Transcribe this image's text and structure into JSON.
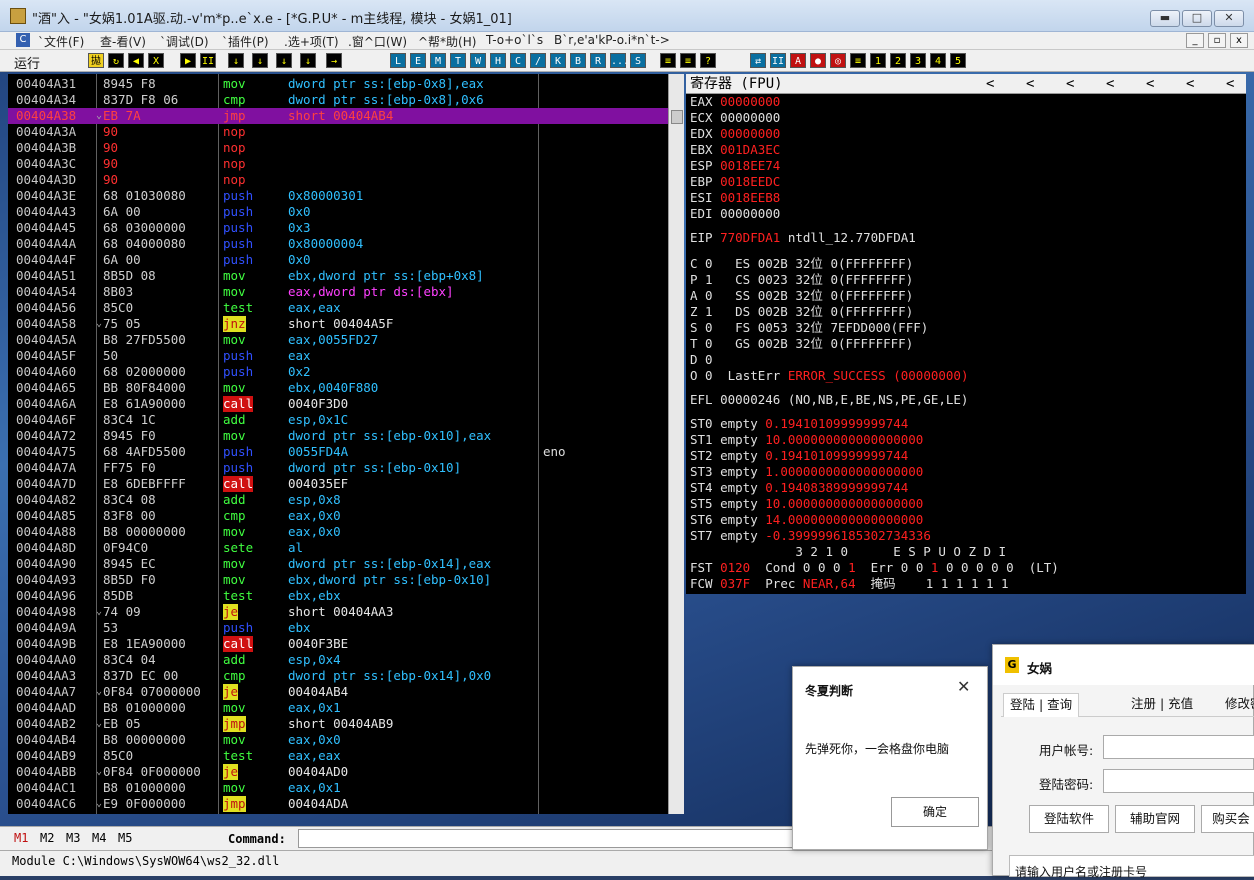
{
  "window": {
    "title": "\"酒\"入 - \"女娲1.01A驱.动.-v'm*p..e`x.e - [*G.P.U* - m主线程, 模块 - 女娲1_01]",
    "min": "▬",
    "max": "□",
    "close": "✕"
  },
  "menu": {
    "items": [
      "`文件(F)",
      "查-看(V)",
      "`调试(D)",
      "`插件(P)",
      ".选+项(T)",
      ".窗^口(W)",
      "^帮*助(H)",
      "T-o+o`l`s",
      "B`r,e'a'kP-o.i*n`t->"
    ],
    "c_icon": "C"
  },
  "toolbar": {
    "run_label": "运行",
    "buttons": [
      "拋",
      "↻",
      "◀",
      "X",
      "▶",
      "II",
      "↓",
      "↓",
      "↓",
      "↓",
      "→",
      "L",
      "E",
      "M",
      "T",
      "W",
      "H",
      "C",
      "/",
      "K",
      "B",
      "R",
      "...",
      "S",
      "≡",
      "≡",
      "?",
      "⇄",
      "II",
      "A",
      "●",
      "◎",
      "≡",
      "1",
      "2",
      "3",
      "4",
      "5"
    ]
  },
  "disasm": [
    {
      "addr": "00404A31",
      "hex": "8945 F8",
      "ins": "mov",
      "ops": "dword ptr ss:[ebp-0x8],eax",
      "c": ""
    },
    {
      "addr": "00404A34",
      "hex": "837D F8 06",
      "ins": "cmp",
      "ops": "dword ptr ss:[ebp-0x8],0x6",
      "c": ""
    },
    {
      "addr": "00404A38",
      "hex": "EB 7A",
      "ins": "jmp",
      "ops": "short 00404AB4",
      "c": "",
      "sel": true
    },
    {
      "addr": "00404A3A",
      "hex": "90",
      "ins": "nop",
      "ops": "",
      "c": ""
    },
    {
      "addr": "00404A3B",
      "hex": "90",
      "ins": "nop",
      "ops": "",
      "c": ""
    },
    {
      "addr": "00404A3C",
      "hex": "90",
      "ins": "nop",
      "ops": "",
      "c": ""
    },
    {
      "addr": "00404A3D",
      "hex": "90",
      "ins": "nop",
      "ops": "",
      "c": ""
    },
    {
      "addr": "00404A3E",
      "hex": "68 01030080",
      "ins": "push",
      "ops": "0x80000301",
      "c": ""
    },
    {
      "addr": "00404A43",
      "hex": "6A 00",
      "ins": "push",
      "ops": "0x0",
      "c": ""
    },
    {
      "addr": "00404A45",
      "hex": "68 03000000",
      "ins": "push",
      "ops": "0x3",
      "c": ""
    },
    {
      "addr": "00404A4A",
      "hex": "68 04000080",
      "ins": "push",
      "ops": "0x80000004",
      "c": ""
    },
    {
      "addr": "00404A4F",
      "hex": "6A 00",
      "ins": "push",
      "ops": "0x0",
      "c": ""
    },
    {
      "addr": "00404A51",
      "hex": "8B5D 08",
      "ins": "mov",
      "ops": "ebx,dword ptr ss:[ebp+0x8]",
      "c": ""
    },
    {
      "addr": "00404A54",
      "hex": "8B03",
      "ins": "mov",
      "ops": "eax,dword ptr ds:[ebx]",
      "c": ""
    },
    {
      "addr": "00404A56",
      "hex": "85C0",
      "ins": "test",
      "ops": "eax,eax",
      "c": ""
    },
    {
      "addr": "00404A58",
      "hex": "75 05",
      "ins": "jnz",
      "ops": "short 00404A5F",
      "c": ""
    },
    {
      "addr": "00404A5A",
      "hex": "B8 27FD5500",
      "ins": "mov",
      "ops": "eax,0055FD27",
      "c": ""
    },
    {
      "addr": "00404A5F",
      "hex": "50",
      "ins": "push",
      "ops": "eax",
      "c": ""
    },
    {
      "addr": "00404A60",
      "hex": "68 02000000",
      "ins": "push",
      "ops": "0x2",
      "c": ""
    },
    {
      "addr": "00404A65",
      "hex": "BB 80F84000",
      "ins": "mov",
      "ops": "ebx,0040F880",
      "c": ""
    },
    {
      "addr": "00404A6A",
      "hex": "E8 61A90000",
      "ins": "call",
      "ops": "0040F3D0",
      "c": ""
    },
    {
      "addr": "00404A6F",
      "hex": "83C4 1C",
      "ins": "add",
      "ops": "esp,0x1C",
      "c": ""
    },
    {
      "addr": "00404A72",
      "hex": "8945 F0",
      "ins": "mov",
      "ops": "dword ptr ss:[ebp-0x10],eax",
      "c": ""
    },
    {
      "addr": "00404A75",
      "hex": "68 4AFD5500",
      "ins": "push",
      "ops": "0055FD4A",
      "c": "eno"
    },
    {
      "addr": "00404A7A",
      "hex": "FF75 F0",
      "ins": "push",
      "ops": "dword ptr ss:[ebp-0x10]",
      "c": ""
    },
    {
      "addr": "00404A7D",
      "hex": "E8 6DEBFFFF",
      "ins": "call",
      "ops": "004035EF",
      "c": ""
    },
    {
      "addr": "00404A82",
      "hex": "83C4 08",
      "ins": "add",
      "ops": "esp,0x8",
      "c": ""
    },
    {
      "addr": "00404A85",
      "hex": "83F8 00",
      "ins": "cmp",
      "ops": "eax,0x0",
      "c": ""
    },
    {
      "addr": "00404A88",
      "hex": "B8 00000000",
      "ins": "mov",
      "ops": "eax,0x0",
      "c": ""
    },
    {
      "addr": "00404A8D",
      "hex": "0F94C0",
      "ins": "sete",
      "ops": "al",
      "c": ""
    },
    {
      "addr": "00404A90",
      "hex": "8945 EC",
      "ins": "mov",
      "ops": "dword ptr ss:[ebp-0x14],eax",
      "c": ""
    },
    {
      "addr": "00404A93",
      "hex": "8B5D F0",
      "ins": "mov",
      "ops": "ebx,dword ptr ss:[ebp-0x10]",
      "c": ""
    },
    {
      "addr": "00404A96",
      "hex": "85DB",
      "ins": "test",
      "ops": "ebx,ebx",
      "c": ""
    },
    {
      "addr": "00404A98",
      "hex": "74 09",
      "ins": "je",
      "ops": "short 00404AA3",
      "c": ""
    },
    {
      "addr": "00404A9A",
      "hex": "53",
      "ins": "push",
      "ops": "ebx",
      "c": ""
    },
    {
      "addr": "00404A9B",
      "hex": "E8 1EA90000",
      "ins": "call",
      "ops": "0040F3BE",
      "c": ""
    },
    {
      "addr": "00404AA0",
      "hex": "83C4 04",
      "ins": "add",
      "ops": "esp,0x4",
      "c": ""
    },
    {
      "addr": "00404AA3",
      "hex": "837D EC 00",
      "ins": "cmp",
      "ops": "dword ptr ss:[ebp-0x14],0x0",
      "c": ""
    },
    {
      "addr": "00404AA7",
      "hex": "0F84 07000000",
      "ins": "je",
      "ops": "00404AB4",
      "c": ""
    },
    {
      "addr": "00404AAD",
      "hex": "B8 01000000",
      "ins": "mov",
      "ops": "eax,0x1",
      "c": ""
    },
    {
      "addr": "00404AB2",
      "hex": "EB 05",
      "ins": "jmp",
      "ops": "short 00404AB9",
      "c": ""
    },
    {
      "addr": "00404AB4",
      "hex": "B8 00000000",
      "ins": "mov",
      "ops": "eax,0x0",
      "c": ""
    },
    {
      "addr": "00404AB9",
      "hex": "85C0",
      "ins": "test",
      "ops": "eax,eax",
      "c": ""
    },
    {
      "addr": "00404ABB",
      "hex": "0F84 0F000000",
      "ins": "je",
      "ops": "00404AD0",
      "c": ""
    },
    {
      "addr": "00404AC1",
      "hex": "B8 01000000",
      "ins": "mov",
      "ops": "eax,0x1",
      "c": ""
    },
    {
      "addr": "00404AC6",
      "hex": "E9 0F000000",
      "ins": "jmp",
      "ops": "00404ADA",
      "c": ""
    }
  ],
  "registers": {
    "title": "寄存器 (FPU)",
    "nav": [
      "<",
      "<",
      "<",
      "<",
      "<",
      "<",
      "<"
    ],
    "gp": [
      [
        "EAX",
        "00000000",
        true
      ],
      [
        "ECX",
        "00000000",
        false
      ],
      [
        "EDX",
        "00000000",
        true
      ],
      [
        "EBX",
        "001DA3EC",
        true
      ],
      [
        "ESP",
        "0018EE74",
        true
      ],
      [
        "EBP",
        "0018EEDC",
        true
      ],
      [
        "ESI",
        "0018EEB8",
        true
      ],
      [
        "EDI",
        "00000000",
        false
      ]
    ],
    "eip_label": "EIP",
    "eip_val": "770DFDA1",
    "eip_sym": "ntdll_12.770DFDA1",
    "flags": [
      {
        "f": "C 0",
        "seg": "ES 002B 32位 0(FFFFFFFF)"
      },
      {
        "f": "P 1",
        "seg": "CS 0023 32位 0(FFFFFFFF)"
      },
      {
        "f": "A 0",
        "seg": "SS 002B 32位 0(FFFFFFFF)"
      },
      {
        "f": "Z 1",
        "seg": "DS 002B 32位 0(FFFFFFFF)"
      },
      {
        "f": "S 0",
        "seg": "FS 0053 32位 7EFDD000(FFF)"
      },
      {
        "f": "T 0",
        "seg": "GS 002B 32位 0(FFFFFFFF)"
      },
      {
        "f": "D 0",
        "seg": ""
      }
    ],
    "o_flag": "O 0",
    "lasterr_label": "LastErr",
    "lasterr_val": "ERROR_SUCCESS (00000000)",
    "efl": "EFL 00000246 (NO,NB,E,BE,NS,PE,GE,LE)",
    "st": [
      [
        "ST0",
        "empty",
        "0.19410109999999744"
      ],
      [
        "ST1",
        "empty",
        "10.000000000000000000"
      ],
      [
        "ST2",
        "empty",
        "0.19410109999999744"
      ],
      [
        "ST3",
        "empty",
        "1.0000000000000000000"
      ],
      [
        "ST4",
        "empty",
        "0.19408389999999744"
      ],
      [
        "ST5",
        "empty",
        "10.000000000000000000"
      ],
      [
        "ST6",
        "empty",
        "14.000000000000000000"
      ],
      [
        "ST7",
        "empty",
        "-0.3999996185302734336"
      ]
    ],
    "bits_hdr": "3 2 1 0      E S P U O Z D I",
    "fst_label": "FST",
    "fst_val": "0120",
    "fst_cond": "Cond 0 0 0",
    "fst_c": "1",
    "fst_err": "Err 0 0",
    "fst_e": "1",
    "fst_rest": "0 0 0 0 0  (LT)",
    "fcw_label": "FCW",
    "fcw_val": "037F",
    "fcw_prec": "Prec",
    "fcw_near": "NEAR,64",
    "fcw_mask": "掩码",
    "fcw_bits": "1 1 1 1 1 1"
  },
  "bottom": {
    "tabs": [
      "M1",
      "M2",
      "M3",
      "M4",
      "M5"
    ],
    "command_label": "Command:",
    "status": "Module C:\\Windows\\SysWOW64\\ws2_32.dll"
  },
  "dialog1": {
    "title": "冬夏判断",
    "close": "✕",
    "message": "先弹死你，一会格盘你电脑",
    "ok": "确定"
  },
  "dialog2": {
    "title": "女娲",
    "icon": "G",
    "tabs": [
      "登陆 | 查询",
      "注册 | 充值",
      "修改密"
    ],
    "user_label": "用户帐号:",
    "pass_label": "登陆密码:",
    "btn_login": "登陆软件",
    "btn_site": "辅助官网",
    "btn_buy": "购买会",
    "hint": "请输入用户名或注册卡号"
  }
}
